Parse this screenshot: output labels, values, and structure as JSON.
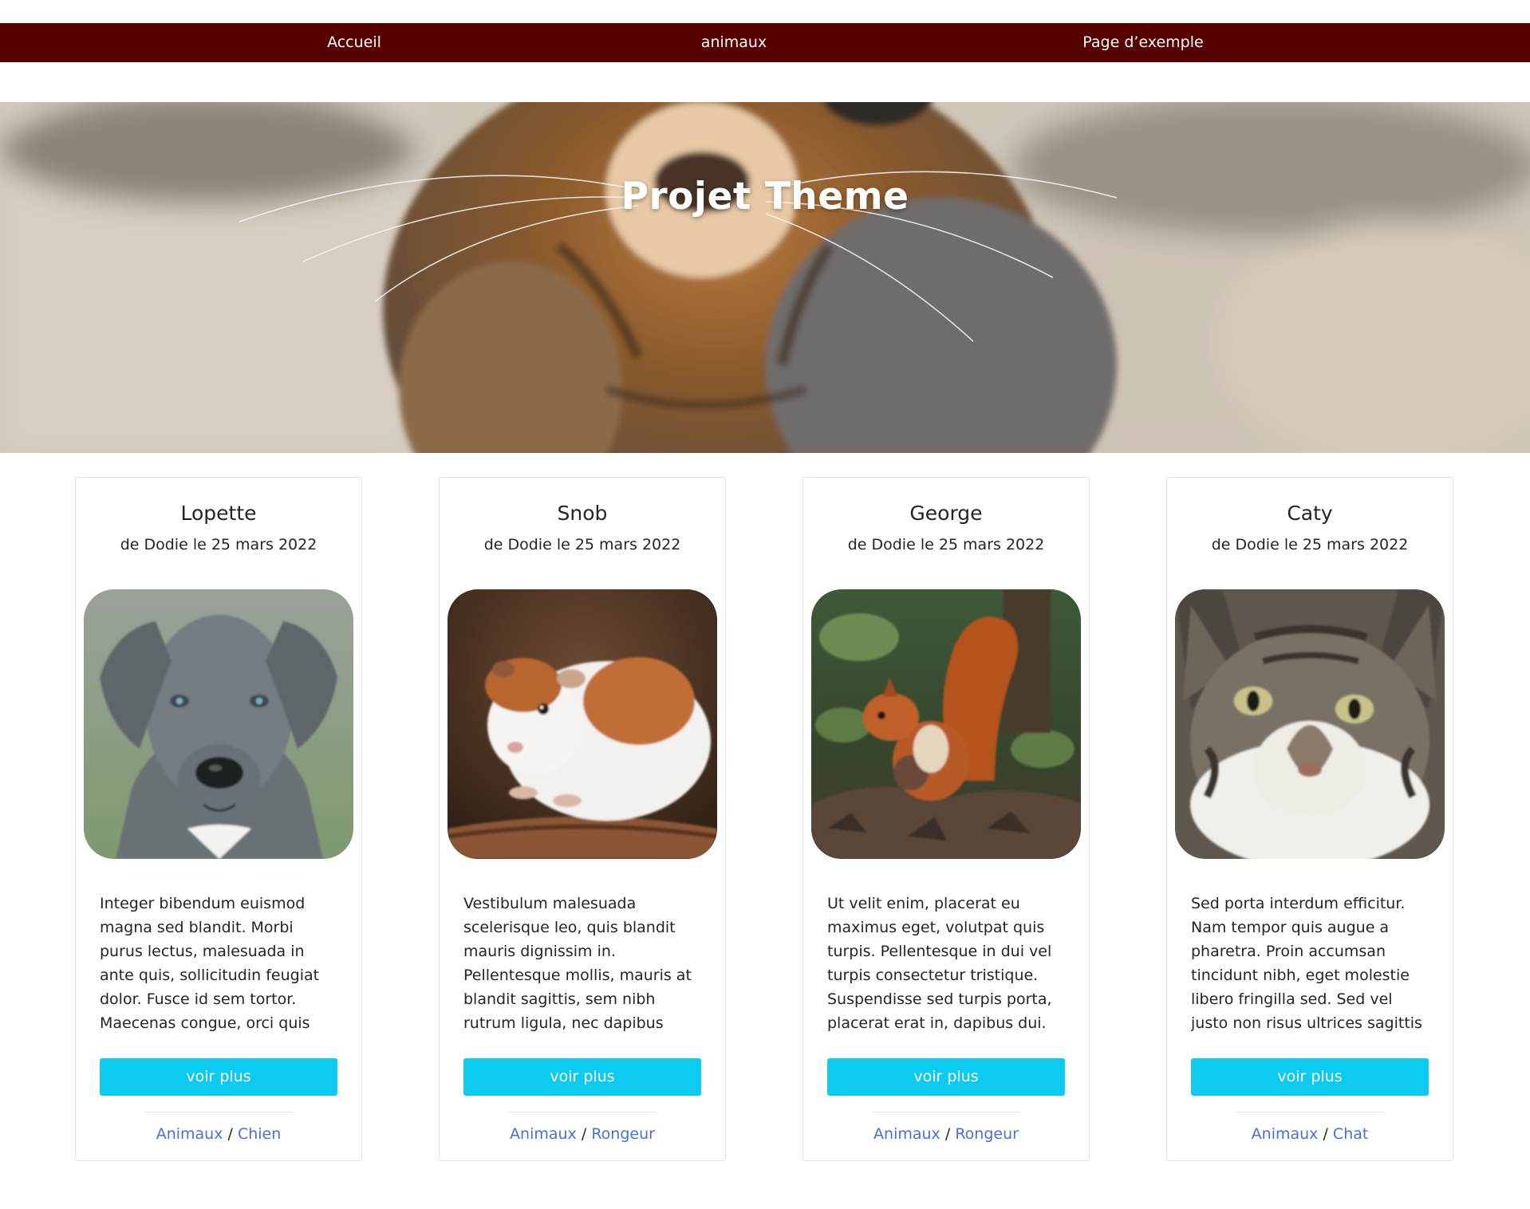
{
  "nav": {
    "items": [
      {
        "label": "Accueil"
      },
      {
        "label": "animaux"
      },
      {
        "label": "Page d’exemple"
      }
    ]
  },
  "hero": {
    "title": "Projet Theme",
    "image": "kitten-closeup-photo"
  },
  "cards": [
    {
      "title": "Lopette",
      "meta": "de Dodie le 25 mars 2022",
      "image": "grey-dog-photo",
      "excerpt": "Integer bibendum euismod magna sed blandit. Morbi purus lectus, malesuada in ante quis, sollicitudin feugiat dolor. Fusce id sem tortor. Maecenas congue, orci quis hendrerit tincidunt, sem sem consequat",
      "button": "voir plus",
      "category": "Animaux",
      "separator": "/",
      "subcategory": "Chien"
    },
    {
      "title": "Snob",
      "meta": "de Dodie le 25 mars 2022",
      "image": "guinea-pig-photo",
      "excerpt": "Vestibulum malesuada scelerisque leo, quis blandit mauris dignissim in. Pellentesque mollis, mauris at blandit sagittis, sem nibh rutrum ligula, nec dapibus augue dolor sit amet ipsum. Curabitur egestas,",
      "button": "voir plus",
      "category": "Animaux",
      "separator": "/",
      "subcategory": "Rongeur"
    },
    {
      "title": "George",
      "meta": "de Dodie le 25 mars 2022",
      "image": "red-squirrel-photo",
      "excerpt": "Ut velit enim, placerat eu maximus eget, volutpat quis turpis. Pellentesque in dui vel turpis consectetur tristique. Suspendisse sed turpis porta, placerat erat in, dapibus dui. Ut varius urna nisi, ut fermentum est",
      "button": "voir plus",
      "category": "Animaux",
      "separator": "/",
      "subcategory": "Rongeur"
    },
    {
      "title": "Caty",
      "meta": "de Dodie le 25 mars 2022",
      "image": "tabby-cat-photo",
      "excerpt": "Sed porta interdum efficitur. Nam tempor quis augue a pharetra. Proin accumsan tincidunt nibh, eget molestie libero fringilla sed. Sed vel justo non risus ultrices sagittis vel at ligula. In hac habitasse platea",
      "button": "voir plus",
      "category": "Animaux",
      "separator": "/",
      "subcategory": "Chat"
    }
  ],
  "colors": {
    "navbar": "#560000",
    "button": "#0dcaf0",
    "link": "#4a6fd6"
  }
}
